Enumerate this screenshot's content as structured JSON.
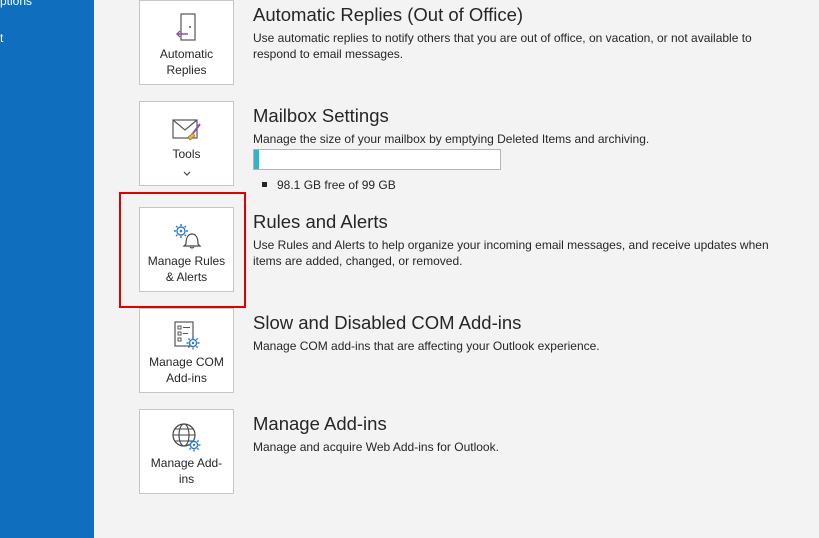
{
  "sidebar": {
    "items": [
      {
        "label": "ptions"
      },
      {
        "label": "t"
      }
    ]
  },
  "tiles": [
    {
      "label_line1": "Automatic",
      "label_line2": "Replies",
      "icon": "automatic-replies-icon"
    },
    {
      "label_line1": "Tools",
      "label_line2": "",
      "icon": "mailbox-tools-icon",
      "has_dropdown": true,
      "dropdown_icon": "chevron-down-icon"
    },
    {
      "label_line1": "Manage Rules",
      "label_line2": "& Alerts",
      "icon": "rules-alerts-icon"
    },
    {
      "label_line1": "Manage COM",
      "label_line2": "Add-ins",
      "icon": "com-addins-icon"
    },
    {
      "label_line1": "Manage Add-",
      "label_line2": "ins",
      "icon": "web-addins-icon"
    }
  ],
  "sections": {
    "auto_replies": {
      "title": "Automatic Replies (Out of Office)",
      "description": "Use automatic replies to notify others that you are out of office, on vacation, or not available to respond to email messages."
    },
    "mailbox_settings": {
      "title": "Mailbox Settings",
      "description": "Manage the size of your mailbox by emptying Deleted Items and archiving.",
      "usage_percent": 2,
      "storage_text": "98.1 GB free of 99 GB"
    },
    "rules_alerts": {
      "title": "Rules and Alerts",
      "description": "Use Rules and Alerts to help organize your incoming email messages, and receive updates when items are added, changed, or removed."
    },
    "com_addins": {
      "title": "Slow and Disabled COM Add-ins",
      "description": "Manage COM add-ins that are affecting your Outlook experience."
    },
    "manage_addins": {
      "title": "Manage Add-ins",
      "description": "Manage and acquire Web Add-ins for Outlook."
    }
  },
  "colors": {
    "sidebar": "#106ebe",
    "highlight": "#e00000",
    "progress_fill": "#2fb5c9",
    "icon_blue": "#2e7bcf",
    "icon_purple": "#8a4fb1"
  }
}
